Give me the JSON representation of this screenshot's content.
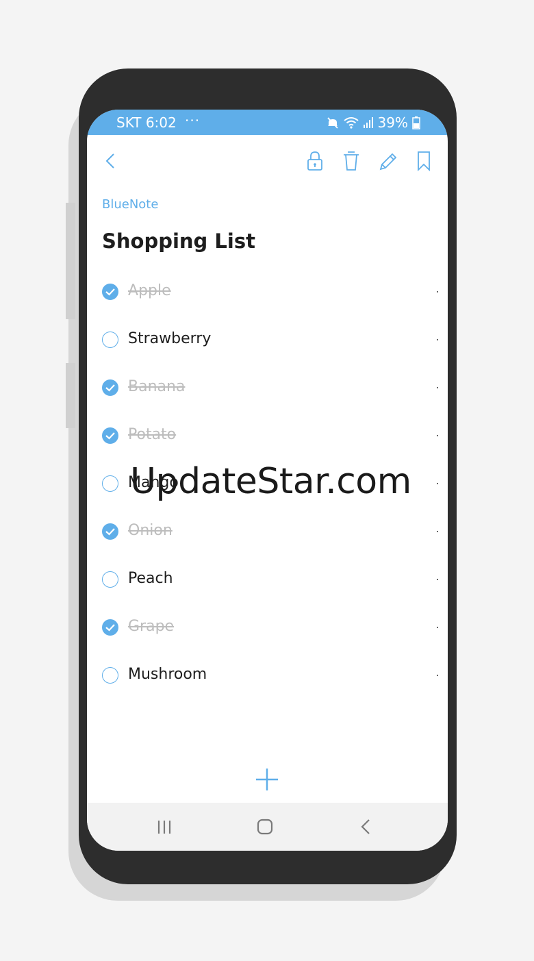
{
  "colors": {
    "accent": "#5faee9",
    "text": "#1e1e1e",
    "done_text": "#bdbdbd"
  },
  "status_bar": {
    "carrier_time": "SKT 6:02",
    "dots": "···",
    "battery": "39%"
  },
  "toolbar": {
    "back_icon": "chevron-left-icon",
    "actions": [
      "lock-icon",
      "trash-icon",
      "pencil-icon",
      "bookmark-icon"
    ]
  },
  "note": {
    "app_label": "BlueNote",
    "title": "Shopping List"
  },
  "items": [
    {
      "label": "Apple",
      "checked": true
    },
    {
      "label": "Strawberry",
      "checked": false
    },
    {
      "label": "Banana",
      "checked": true
    },
    {
      "label": "Potato",
      "checked": true
    },
    {
      "label": "Mango",
      "checked": false
    },
    {
      "label": "Onion",
      "checked": true
    },
    {
      "label": "Peach",
      "checked": false
    },
    {
      "label": "Grape",
      "checked": true
    },
    {
      "label": "Mushroom",
      "checked": false
    }
  ],
  "watermark": "UpdateStar.com"
}
